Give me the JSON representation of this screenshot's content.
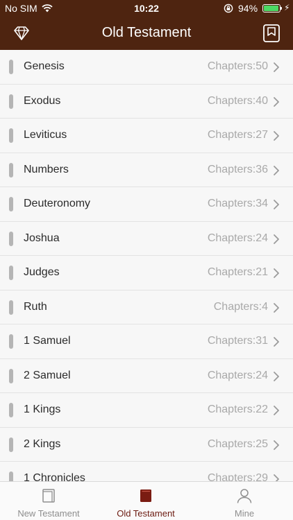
{
  "status_bar": {
    "carrier": "No SIM",
    "time": "10:22",
    "battery_percent": "94%",
    "battery_level": 0.94,
    "battery_color": "#4cd964"
  },
  "nav": {
    "title": "Old Testament",
    "left_icon": "diamond-icon",
    "right_icon": "bookmark-icon",
    "background": "#4e2410"
  },
  "books": [
    {
      "name": "Genesis",
      "chapters": "Chapters:50"
    },
    {
      "name": "Exodus",
      "chapters": "Chapters:40"
    },
    {
      "name": "Leviticus",
      "chapters": "Chapters:27"
    },
    {
      "name": "Numbers",
      "chapters": "Chapters:36"
    },
    {
      "name": "Deuteronomy",
      "chapters": "Chapters:34"
    },
    {
      "name": "Joshua",
      "chapters": "Chapters:24"
    },
    {
      "name": "Judges",
      "chapters": "Chapters:21"
    },
    {
      "name": "Ruth",
      "chapters": "Chapters:4"
    },
    {
      "name": "1 Samuel",
      "chapters": "Chapters:31"
    },
    {
      "name": "2 Samuel",
      "chapters": "Chapters:24"
    },
    {
      "name": "1 Kings",
      "chapters": "Chapters:22"
    },
    {
      "name": "2 Kings",
      "chapters": "Chapters:25"
    },
    {
      "name": "1 Chronicles",
      "chapters": "Chapters:29"
    }
  ],
  "tab_bar": {
    "tabs": [
      {
        "label": "New Testament",
        "icon": "book-outline-icon",
        "active": false
      },
      {
        "label": "Old Testament",
        "icon": "book-filled-icon",
        "active": true
      },
      {
        "label": "Mine",
        "icon": "person-icon",
        "active": false
      }
    ],
    "active_color": "#6b1a10",
    "inactive_color": "#8e8e8e"
  }
}
